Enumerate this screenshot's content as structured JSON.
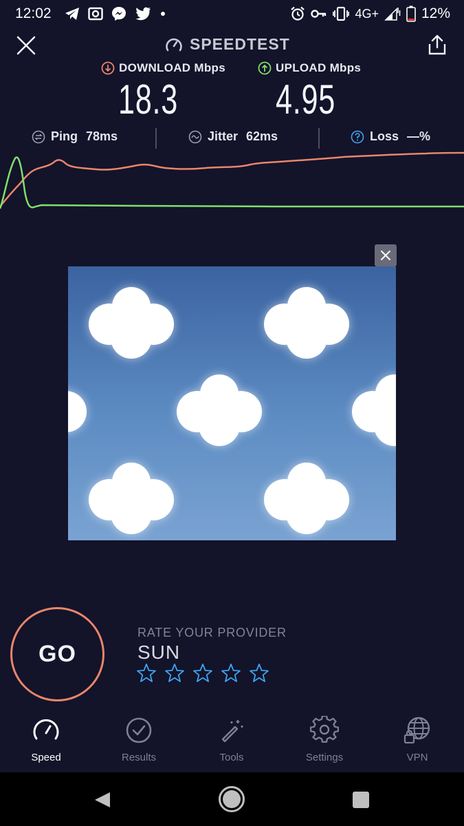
{
  "status_bar": {
    "time": "12:02",
    "network": "4G+",
    "battery": "12%",
    "left_icons": [
      "telegram-icon",
      "cast-icon",
      "messenger-icon",
      "twitter-icon",
      "dot-icon"
    ],
    "right_icons": [
      "alarm-icon",
      "vpn-key-icon",
      "vibrate-icon",
      "signal-icon",
      "battery-icon"
    ]
  },
  "header": {
    "title": "SPEEDTEST"
  },
  "download": {
    "label": "DOWNLOAD Mbps",
    "value": "18.3",
    "color": "#e9866a"
  },
  "upload": {
    "label": "UPLOAD Mbps",
    "value": "4.95",
    "color": "#7fe06a"
  },
  "stats": {
    "ping_label": "Ping",
    "ping_value": "78ms",
    "jitter_label": "Jitter",
    "jitter_value": "62ms",
    "loss_label": "Loss",
    "loss_value": "—%"
  },
  "go": {
    "label": "GO",
    "ring_color": "#e9866a"
  },
  "rating": {
    "prompt": "RATE YOUR PROVIDER",
    "provider": "SUN",
    "stars": 5,
    "star_color": "#3fa5ef"
  },
  "nav": {
    "items": [
      {
        "label": "Speed",
        "icon": "speedometer-icon",
        "active": true
      },
      {
        "label": "Results",
        "icon": "checkmark-circle-icon",
        "active": false
      },
      {
        "label": "Tools",
        "icon": "magic-wand-icon",
        "active": false
      },
      {
        "label": "Settings",
        "icon": "gear-icon",
        "active": false
      },
      {
        "label": "VPN",
        "icon": "globe-lock-icon",
        "active": false
      }
    ]
  }
}
